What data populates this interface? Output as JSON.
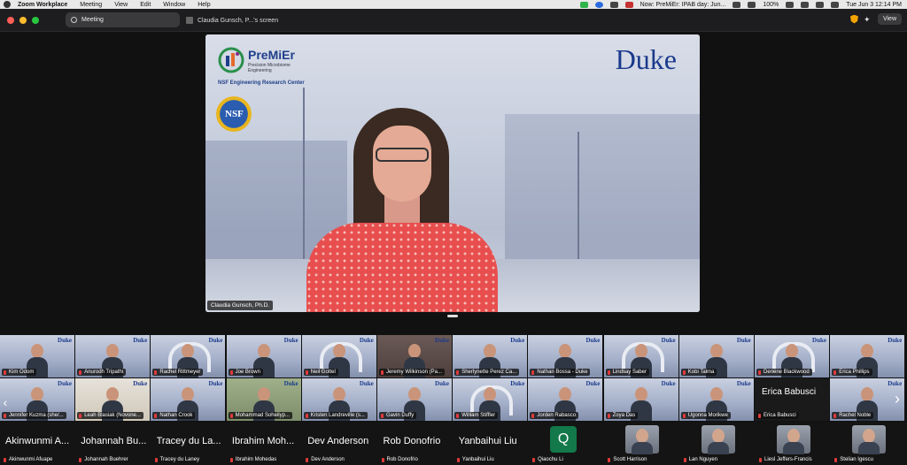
{
  "menubar": {
    "app_name": "Zoom Workplace",
    "items": [
      "Meeting",
      "View",
      "Edit",
      "Window",
      "Help"
    ],
    "now_playing": "Now: PreMiEr: IPAB day: Jun...",
    "battery": "100%",
    "datetime": "Tue Jun 3  12:14 PM"
  },
  "titlebar": {
    "tab_label": "Meeting",
    "screen_label": "Claudia Gunsch, P...'s screen",
    "view_label": "View"
  },
  "share": {
    "premier_title": "PreMiEr",
    "premier_sub": "Precision Microbiome\nEngineering",
    "nsf_erc": "NSF Engineering Research Center",
    "nsf": "NSF",
    "duke": "Duke",
    "speaker_name": "Claudia Gunsch, Ph.D."
  },
  "gallery": {
    "row1": [
      "Kim Odom",
      "Anurodh Tripathi",
      "Rachel Rittmeyer",
      "Joe Brown",
      "Neil Gottel",
      "Jeremy Wilkinson (Pa...",
      "Sherlynette Perez Ca...",
      "Nathan Bossa - Duke",
      "Lindsay Saber",
      "Kobi Talma",
      "Denene Blackwood",
      "Erica Phillips"
    ],
    "row2": [
      "Jennifer Kuzma (she/...",
      "Leah Blasiak (Novone...",
      "Nathan Crook",
      "Mohammad Soheilyp...",
      "Kristen Landreville (s...",
      "Gavin Duffy",
      "William Stiffler",
      "Jorden Rabasco",
      "Zoya Das",
      "Ugonna Morikwe",
      "Erica Babusci",
      "Rachel Noble"
    ],
    "erica_big": "Erica Babusci"
  },
  "bottom": [
    {
      "big": "Akinwunmi A...",
      "small": "Akinwunmi Afuape"
    },
    {
      "big": "Johannah Bu...",
      "small": "Johannah Buehrer"
    },
    {
      "big": "Tracey du La...",
      "small": "Tracey du Laney"
    },
    {
      "big": "Ibrahim Moh...",
      "small": "Ibrahim Mohedas"
    },
    {
      "big": "Dev Anderson",
      "small": "Dev Anderson"
    },
    {
      "big": "Rob Donofrio",
      "small": "Rob Donofrio"
    },
    {
      "big": "Yanbaihui Liu",
      "small": "Yanbaihui Liu"
    },
    {
      "letter": "Q",
      "small": "Qiaochu Li"
    },
    {
      "small": "Scott Harrison"
    },
    {
      "small": "Lan Nguyen"
    },
    {
      "small": "Liesl Jeffers-Francis"
    },
    {
      "small": "Stelian Igescu"
    }
  ]
}
